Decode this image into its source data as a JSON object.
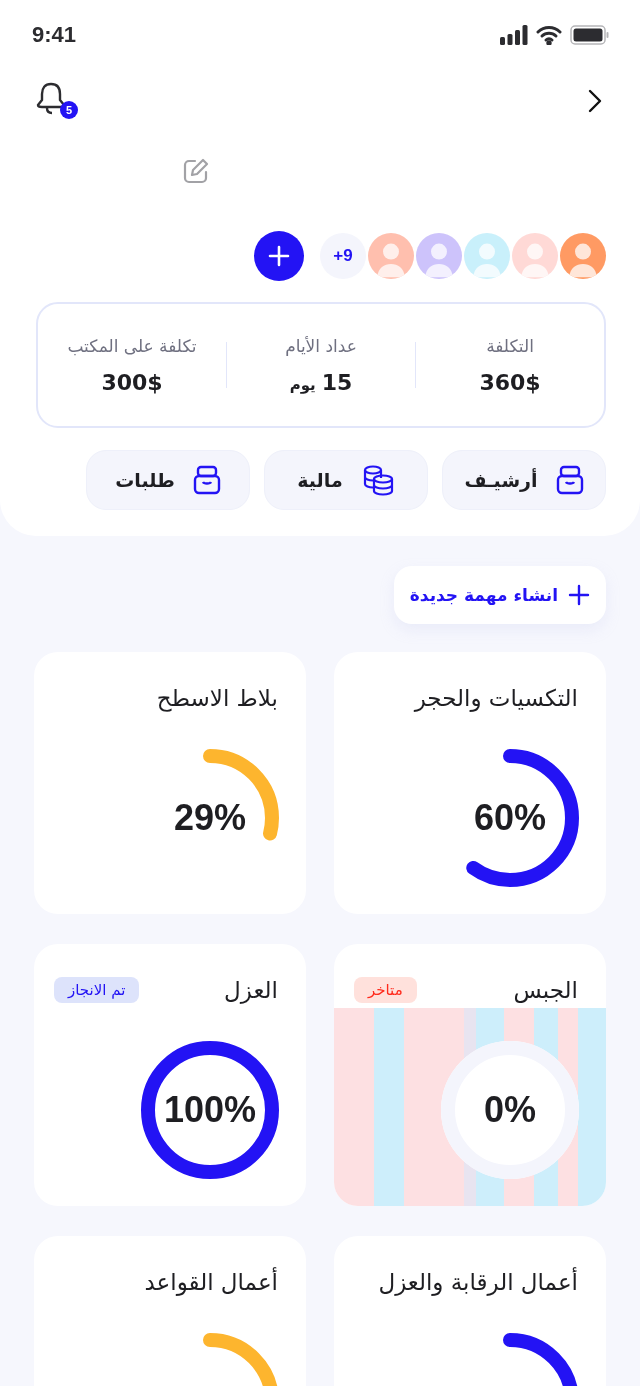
{
  "status_bar": {
    "time": "9:41"
  },
  "header": {
    "notification_count": "5"
  },
  "team": {
    "more_count": "+9",
    "avatars": [
      {
        "color": "#ff9a63"
      },
      {
        "color": "#ffd9d6"
      },
      {
        "color": "#c9f0fb"
      },
      {
        "color": "#cdc3fb"
      },
      {
        "color": "#ffbfae"
      }
    ]
  },
  "stats": [
    {
      "label": "التكلفة",
      "value": "360$"
    },
    {
      "label": "عداد الأيام",
      "value": "15",
      "unit": "يوم"
    },
    {
      "label": "تكلفة على المكتب",
      "value": "300$"
    }
  ],
  "shortcuts": [
    {
      "label": "أرشيـف",
      "kind": "archive"
    },
    {
      "label": "مالية",
      "kind": "finance"
    },
    {
      "label": "طلبات",
      "kind": "archive"
    }
  ],
  "new_task_button": "انشاء مهمة جديدة",
  "tasks": [
    {
      "title": "التكسيات والحجر",
      "percent": "60%",
      "color": "#2313f4",
      "striped": false
    },
    {
      "title": "بلاط الاسطح",
      "percent": "29%",
      "color": "#fdb52e",
      "striped": false
    },
    {
      "title": "الجبس",
      "percent": "0%",
      "striped": true,
      "status": {
        "kind": "late",
        "label": "متاخر"
      }
    },
    {
      "title": "العزل",
      "percent": "100%",
      "color": "#2313f4",
      "striped": false,
      "status": {
        "kind": "done",
        "label": "تم الانجاز"
      }
    },
    {
      "title": "أعمال الرقابة والعزل",
      "color": "#2313f4",
      "striped": false
    },
    {
      "title": "أعمال القواعد",
      "color": "#fdb52e",
      "striped": false
    }
  ]
}
